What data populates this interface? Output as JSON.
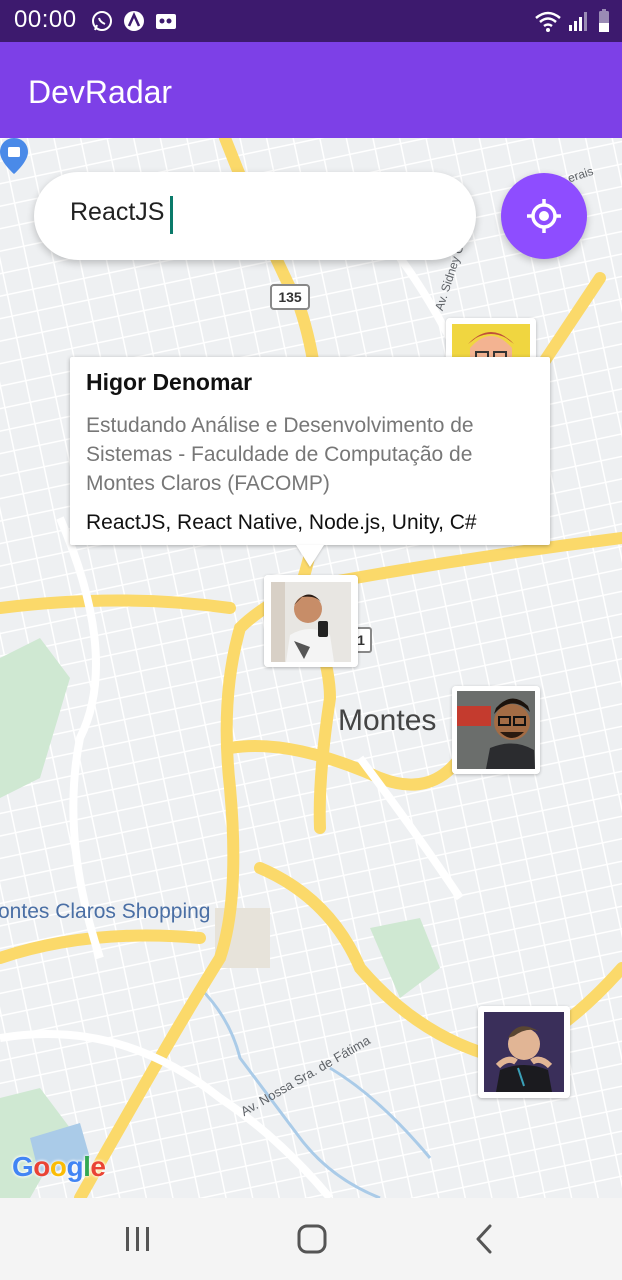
{
  "status_bar": {
    "time": "00:00"
  },
  "app_bar": {
    "title": "DevRadar"
  },
  "search": {
    "value": "ReactJS"
  },
  "map": {
    "labels": {
      "city": "Montes",
      "shopping": "ontes Claros Shopping",
      "street_nossa": "Av. Nossa Sra. de Fátima",
      "street_sidney": "Av. Sidney Chaves",
      "street_gerais": "erais",
      "route_135": "135",
      "route_1": "1"
    },
    "attribution": {
      "G": "G",
      "o1": "o",
      "o2": "o",
      "g": "g",
      "l": "l",
      "e": "e"
    }
  },
  "callout": {
    "name": "Higor Denomar",
    "bio": "Estudando Análise e Desenvolvimento de Sistemas - Faculdade de Computação de Montes Claros (FACOMP)",
    "techs": "ReactJS, React Native, Node.js, Unity, C#"
  },
  "colors": {
    "primary": "#7d40e7",
    "status_bar": "#3d1a6e",
    "locate_button": "#8e4dff",
    "road_major": "#fbd96a",
    "map_bg": "#eef0f2"
  },
  "icons": {
    "locate": "crosshair-icon",
    "nav_recents": "recents-icon",
    "nav_home": "home-icon",
    "nav_back": "back-icon"
  }
}
